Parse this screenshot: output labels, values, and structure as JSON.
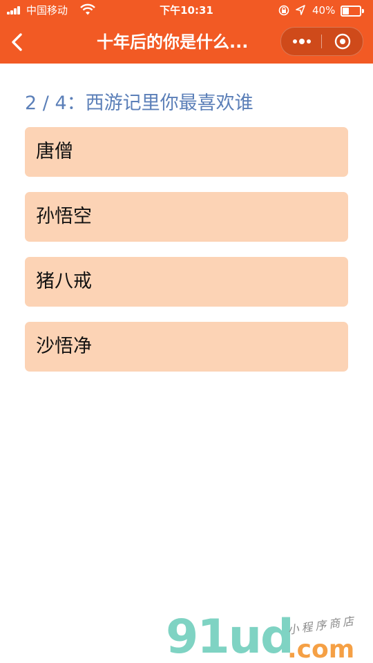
{
  "status_bar": {
    "carrier": "中国移动",
    "time": "下午10:31",
    "battery_percent": "40%",
    "battery_level": 0.4
  },
  "nav": {
    "title": "十年后的你是什么...",
    "back_icon": "chevron-left-icon",
    "more_icon": "more-dots-icon",
    "close_icon": "target-close-icon"
  },
  "quiz": {
    "question": "2 / 4：西游记里你最喜欢谁",
    "options": [
      "唐僧",
      "孙悟空",
      "猪八戒",
      "沙悟净"
    ]
  },
  "watermark": {
    "logo": "91ud",
    "domain": ".com",
    "tagline": "小程序商店"
  },
  "colors": {
    "header_bg": "#f25a24",
    "question_text": "#5b7fb8",
    "option_bg": "#fcd3b5"
  }
}
